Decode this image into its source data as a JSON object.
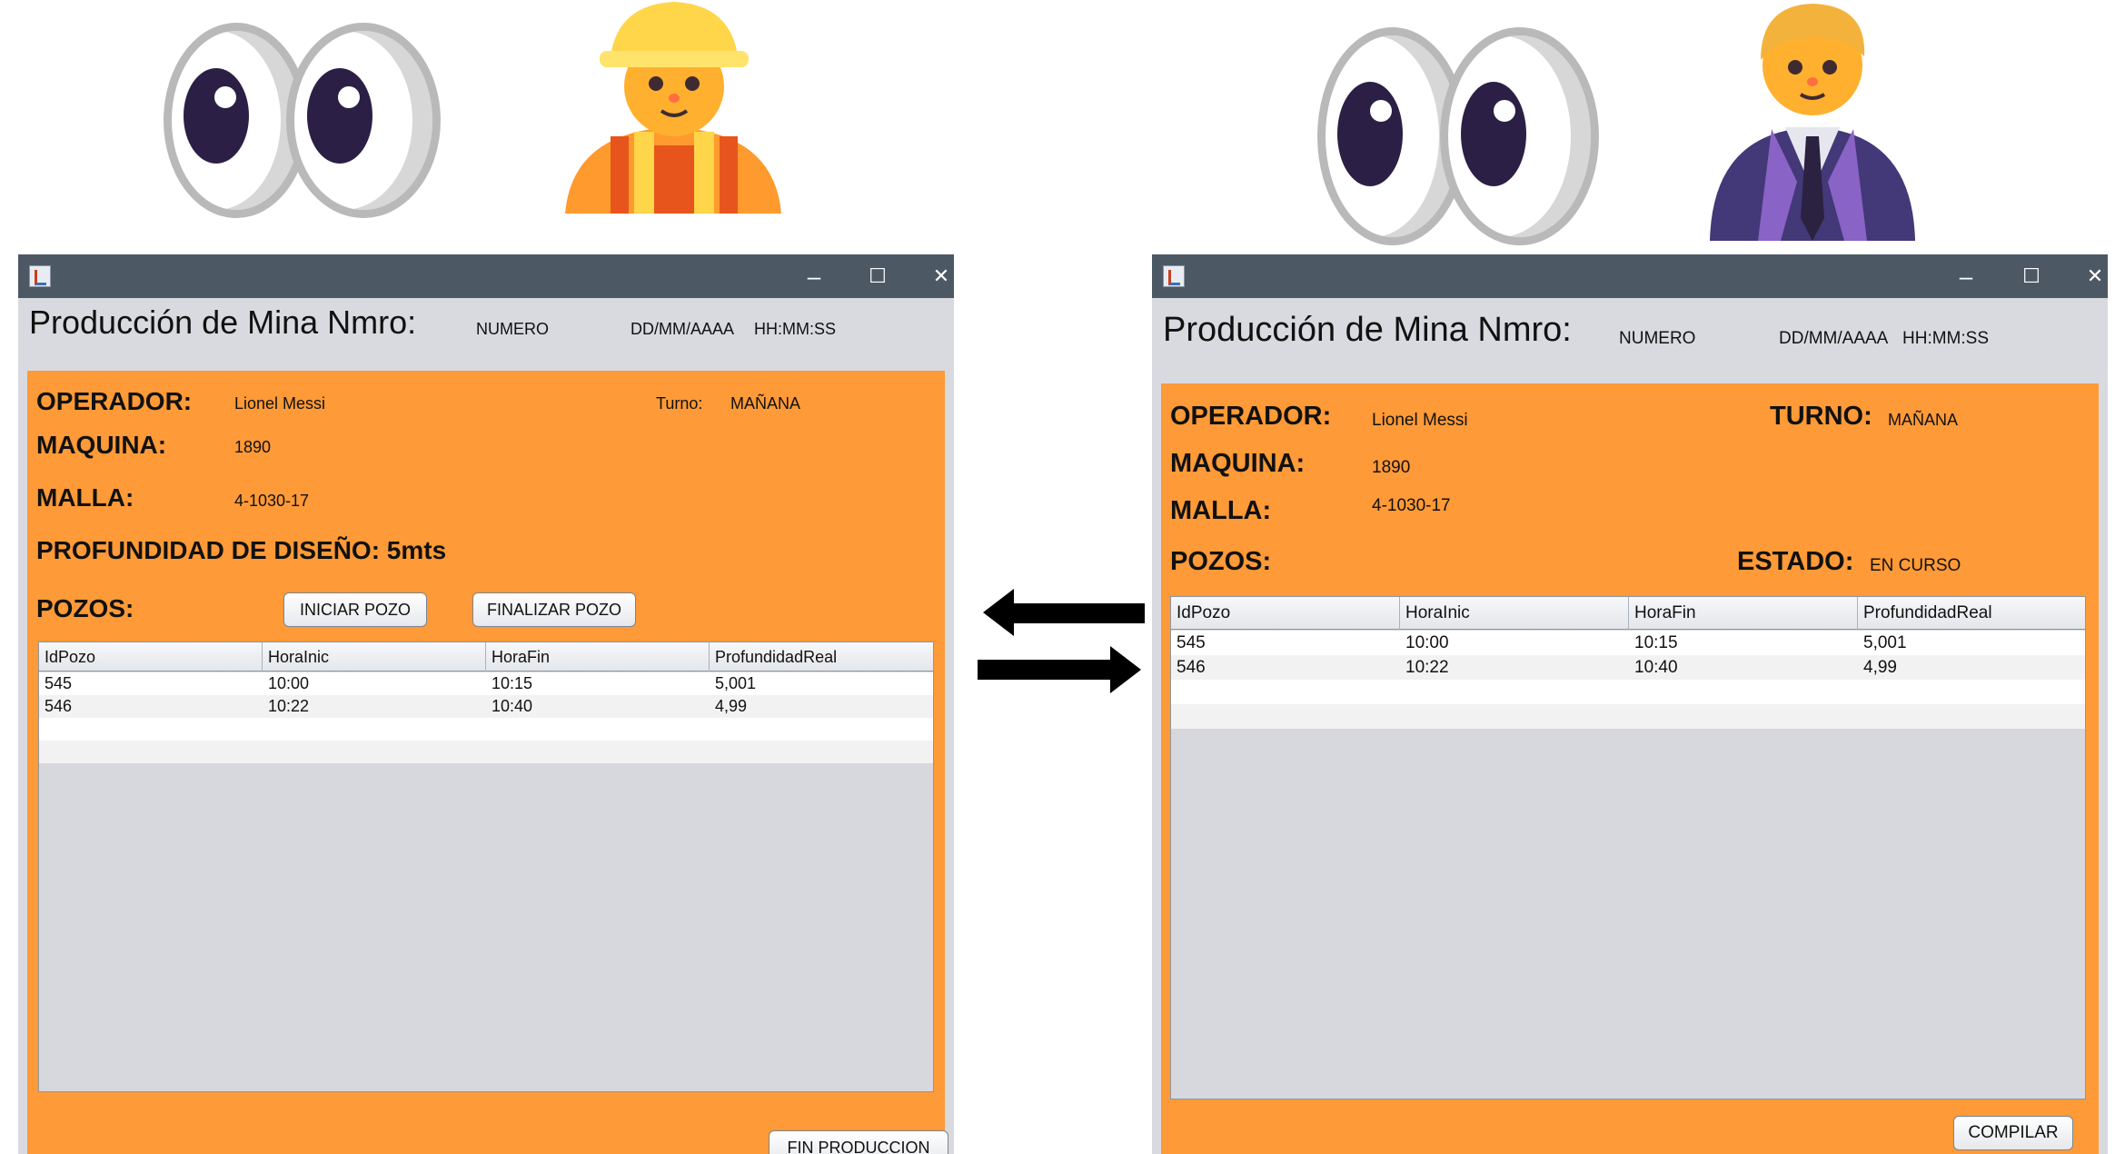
{
  "icons": {
    "left_eyes": "eyes-emoji-icon",
    "left_person": "construction-worker-emoji-icon",
    "right_eyes": "eyes-emoji-icon",
    "right_person": "businessman-emoji-icon",
    "arrow_left": "arrow-left-icon",
    "arrow_right": "arrow-right-icon"
  },
  "colors": {
    "panel_orange": "#fe9a37",
    "window_gray": "#d8dae0",
    "titlebar": "#4d5865"
  },
  "window_controls": {
    "minimize": "–",
    "maximize": "☐",
    "close": "✕"
  },
  "operator_window": {
    "title": "Producción de Mina Nmro:",
    "number": "NUMERO",
    "date": "DD/MM/AAAA",
    "time": "HH:MM:SS",
    "operador_label": "OPERADOR:",
    "operador_value": "Lionel Messi",
    "turno_label": "Turno:",
    "turno_value": "MAÑANA",
    "maquina_label": "MAQUINA:",
    "maquina_value": "1890",
    "malla_label": "MALLA:",
    "malla_value": "4-1030-17",
    "profundidad_label": "PROFUNDIDAD DE DISEÑO: 5mts",
    "pozos_label": "POZOS:",
    "iniciar_button": "INICIAR POZO",
    "finalizar_button": "FINALIZAR POZO",
    "fin_button": "FIN PRODUCCION",
    "table": {
      "columns": [
        "IdPozo",
        "HoraInic",
        "HoraFin",
        "ProfundidadReal"
      ],
      "rows": [
        [
          "545",
          "10:00",
          "10:15",
          "5,001"
        ],
        [
          "546",
          "10:22",
          "10:40",
          "4,99"
        ]
      ]
    }
  },
  "supervisor_window": {
    "title": "Producción de Mina Nmro:",
    "number": "NUMERO",
    "date": "DD/MM/AAAA",
    "time": "HH:MM:SS",
    "operador_label": "OPERADOR:",
    "operador_value": "Lionel Messi",
    "turno_label": "TURNO:",
    "turno_value": "MAÑANA",
    "maquina_label": "MAQUINA:",
    "maquina_value": "1890",
    "malla_label": "MALLA:",
    "malla_value": "4-1030-17",
    "pozos_label": "POZOS:",
    "estado_label": "ESTADO:",
    "estado_value": "EN CURSO",
    "compilar_button": "COMPILAR",
    "table": {
      "columns": [
        "IdPozo",
        "HoraInic",
        "HoraFin",
        "ProfundidadReal"
      ],
      "rows": [
        [
          "545",
          "10:00",
          "10:15",
          "5,001"
        ],
        [
          "546",
          "10:22",
          "10:40",
          "4,99"
        ]
      ]
    }
  }
}
